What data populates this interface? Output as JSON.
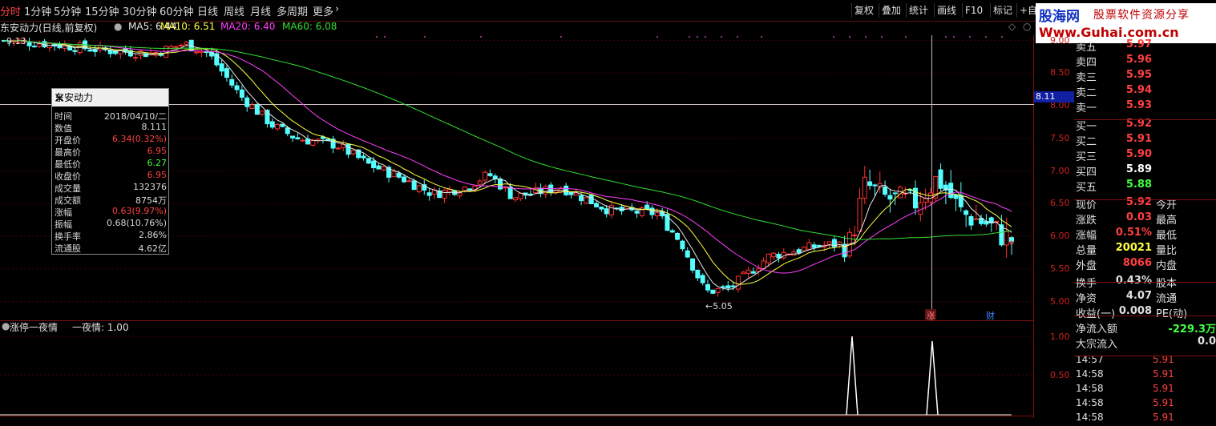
{
  "toolbar": {
    "timeframes": [
      "分时",
      "1分钟",
      "5分钟",
      "15分钟",
      "30分钟",
      "60分钟",
      "日线",
      "周线",
      "月线",
      "多周期",
      "更多"
    ],
    "right_buttons": [
      "复权",
      "叠加",
      "统计",
      "画线",
      "F10",
      "标记",
      "+自"
    ]
  },
  "logo": {
    "line1a": "股海网",
    "line1b": "股票软件资源分享",
    "line2": "Www.Guhai.com.cn"
  },
  "chart": {
    "title": "东安动力(日线,前复权)",
    "ma5": "MA5: 6.44",
    "ma10": "MA10: 6.51",
    "ma20": "MA20: 6.40",
    "ma60": "MA60: 6.08",
    "colors": {
      "up": "#ff3030",
      "down": "#54ffff",
      "ma5": "#e8e8e8",
      "ma10": "#ffff40",
      "ma20": "#ff40ff",
      "ma60": "#30e030"
    },
    "y_ticks": [
      "9.00",
      "8.50",
      "8.00",
      "7.50",
      "7.00",
      "6.50",
      "6.00",
      "5.50",
      "5.00"
    ],
    "high_label": "9.13",
    "low_label": "5.05",
    "crosshair_price": "8.11",
    "markers": {
      "zhang": "涨",
      "cai": "财"
    }
  },
  "popup": {
    "title": "东安动力",
    "rows": [
      {
        "k": "时间",
        "v": "2018/04/10/二",
        "c": "#d8d8d8"
      },
      {
        "k": "数值",
        "v": "8.111",
        "c": "#d8d8d8"
      },
      {
        "k": "开盘价",
        "v": "6.34(0.32%)",
        "c": "#ff4040"
      },
      {
        "k": "最高价",
        "v": "6.95",
        "c": "#ff4040"
      },
      {
        "k": "最低价",
        "v": "6.27",
        "c": "#40ff40"
      },
      {
        "k": "收盘价",
        "v": "6.95",
        "c": "#ff4040"
      },
      {
        "k": "成交量",
        "v": "132376",
        "c": "#d8d8d8"
      },
      {
        "k": "成交额",
        "v": "8754万",
        "c": "#d8d8d8"
      },
      {
        "k": "涨幅",
        "v": "0.63(9.97%)",
        "c": "#ff4040"
      },
      {
        "k": "振幅",
        "v": "0.68(10.76%)",
        "c": "#d8d8d8"
      },
      {
        "k": "换手率",
        "v": "2.86%",
        "c": "#d8d8d8"
      },
      {
        "k": "流通股",
        "v": "4.62亿",
        "c": "#d8d8d8"
      }
    ]
  },
  "indicator": {
    "name": "涨停一夜情",
    "label": "一夜情: 1.00",
    "y_ticks": [
      "1.00",
      "0.50"
    ]
  },
  "orderbook": {
    "sell": [
      {
        "k": "卖五",
        "v": "5.97"
      },
      {
        "k": "卖四",
        "v": "5.96"
      },
      {
        "k": "卖三",
        "v": "5.95"
      },
      {
        "k": "卖二",
        "v": "5.94"
      },
      {
        "k": "卖一",
        "v": "5.93"
      }
    ],
    "buy": [
      {
        "k": "买一",
        "v": "5.92"
      },
      {
        "k": "买二",
        "v": "5.91"
      },
      {
        "k": "买三",
        "v": "5.90"
      },
      {
        "k": "买四",
        "v": "5.89"
      },
      {
        "k": "买五",
        "v": "5.88"
      }
    ]
  },
  "quote": [
    {
      "k": "现价",
      "v": "5.92",
      "c": "#ff4040",
      "k2": "今开"
    },
    {
      "k": "涨跌",
      "v": "0.03",
      "c": "#ff4040",
      "k2": "最高"
    },
    {
      "k": "涨幅",
      "v": "0.51%",
      "c": "#ff4040",
      "k2": "最低"
    },
    {
      "k": "总量",
      "v": "20021",
      "c": "#ffff40",
      "k2": "量比"
    },
    {
      "k": "外盘",
      "v": "8066",
      "c": "#ff4040",
      "k2": "内盘"
    },
    {
      "k": "换手",
      "v": "0.43%",
      "c": "#e0e0e0",
      "k2": "股本"
    },
    {
      "k": "净资",
      "v": "4.07",
      "c": "#e0e0e0",
      "k2": "流通"
    },
    {
      "k": "收益(一)",
      "v": "0.008",
      "c": "#e0e0e0",
      "k2": "PE(动)"
    }
  ],
  "flow": [
    {
      "k": "净流入额",
      "v": "-229.3万",
      "c": "#40ff40"
    },
    {
      "k": "大宗流入",
      "v": "0.0",
      "c": "#e0e0e0"
    }
  ],
  "ticks": [
    {
      "t": "14:57",
      "p": "5.91"
    },
    {
      "t": "14:58",
      "p": "5.91"
    },
    {
      "t": "14:58",
      "p": "5.91"
    },
    {
      "t": "14:58",
      "p": "5.91"
    },
    {
      "t": "14:58",
      "p": "5.91"
    }
  ]
}
